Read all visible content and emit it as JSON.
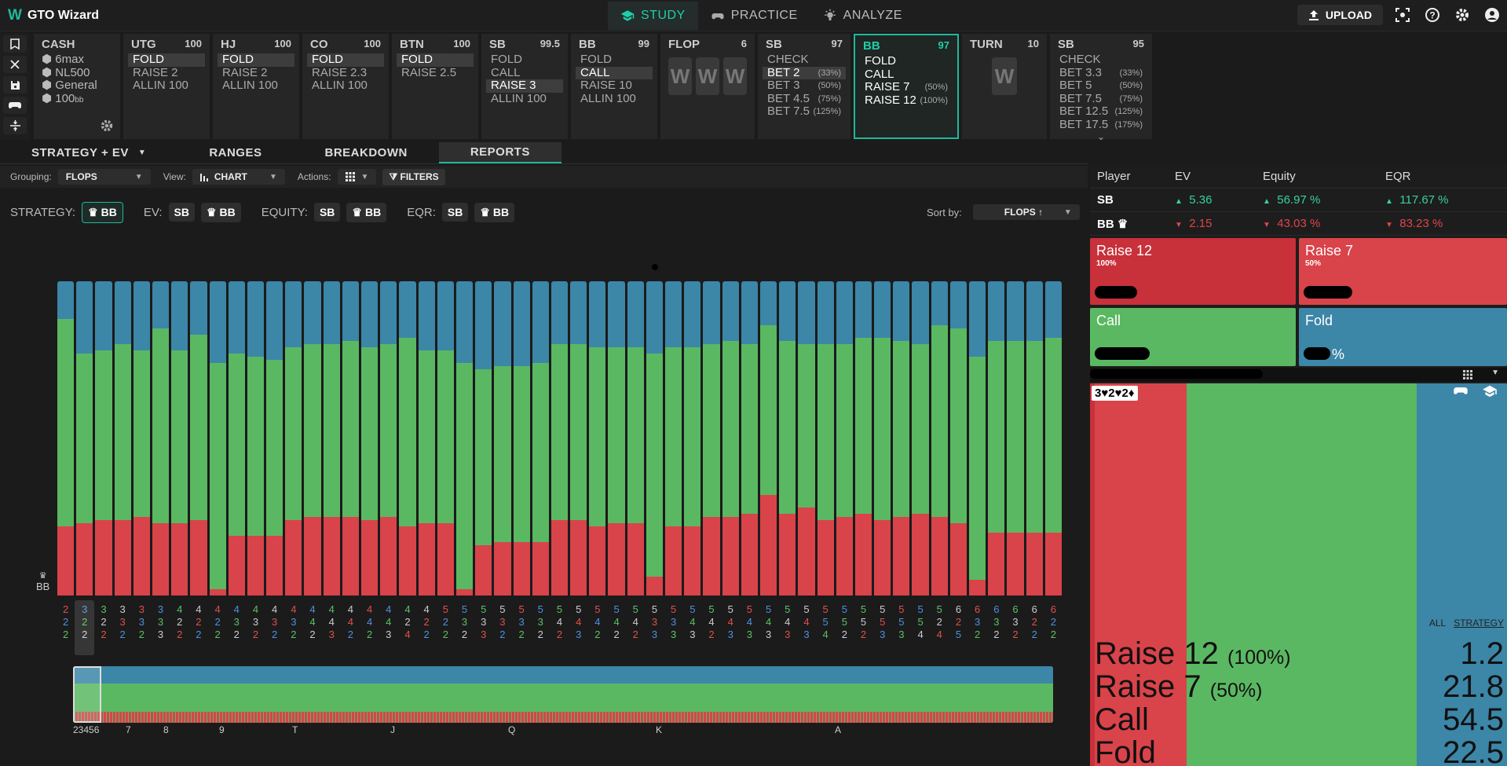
{
  "app": {
    "name": "GTO Wizard",
    "logo_letter": "W"
  },
  "nav": {
    "tabs": [
      {
        "label": "STUDY",
        "icon": "graduation-cap-icon",
        "active": true
      },
      {
        "label": "PRACTICE",
        "icon": "gamepad-icon",
        "active": false
      },
      {
        "label": "ANALYZE",
        "icon": "lightbulb-icon",
        "active": false
      }
    ]
  },
  "topright": {
    "upload_label": "UPLOAD"
  },
  "cash": {
    "title": "CASH",
    "rows": [
      "6max",
      "NL500",
      "General",
      "100"
    ],
    "unit": "bb"
  },
  "nodes": [
    {
      "name": "UTG",
      "stack": "100",
      "actions": [
        {
          "label": "FOLD",
          "sel": true
        },
        {
          "label": "RAISE 2"
        },
        {
          "label": "ALLIN 100"
        }
      ]
    },
    {
      "name": "HJ",
      "stack": "100",
      "actions": [
        {
          "label": "FOLD",
          "sel": true
        },
        {
          "label": "RAISE 2"
        },
        {
          "label": "ALLIN 100"
        }
      ]
    },
    {
      "name": "CO",
      "stack": "100",
      "actions": [
        {
          "label": "FOLD",
          "sel": true
        },
        {
          "label": "RAISE 2.3"
        },
        {
          "label": "ALLIN 100"
        }
      ]
    },
    {
      "name": "BTN",
      "stack": "100",
      "actions": [
        {
          "label": "FOLD",
          "sel": true
        },
        {
          "label": "RAISE 2.5"
        }
      ]
    },
    {
      "name": "SB",
      "stack": "99.5",
      "actions": [
        {
          "label": "FOLD"
        },
        {
          "label": "CALL"
        },
        {
          "label": "RAISE 3",
          "sel": true
        },
        {
          "label": "ALLIN 100"
        }
      ]
    },
    {
      "name": "BB",
      "stack": "99",
      "actions": [
        {
          "label": "FOLD"
        },
        {
          "label": "CALL",
          "sel": true
        },
        {
          "label": "RAISE 10"
        },
        {
          "label": "ALLIN 100"
        }
      ]
    }
  ],
  "flop": {
    "name": "FLOP",
    "count": "6",
    "card": "W"
  },
  "sb_node": {
    "name": "SB",
    "stack": "97",
    "actions": [
      {
        "label": "CHECK",
        "pct": ""
      },
      {
        "label": "BET 2",
        "pct": "(33%)",
        "sel": true
      },
      {
        "label": "BET 3",
        "pct": "(50%)"
      },
      {
        "label": "BET 4.5",
        "pct": "(75%)"
      },
      {
        "label": "BET 7.5",
        "pct": "(125%)"
      }
    ]
  },
  "bb_node": {
    "name": "BB",
    "stack": "97",
    "actions": [
      {
        "label": "FOLD",
        "pct": ""
      },
      {
        "label": "CALL",
        "pct": ""
      },
      {
        "label": "RAISE 7",
        "pct": "(50%)"
      },
      {
        "label": "RAISE 12",
        "pct": "(100%)"
      }
    ]
  },
  "turn": {
    "name": "TURN",
    "count": "10",
    "card": "W"
  },
  "sb2_node": {
    "name": "SB",
    "stack": "95",
    "actions": [
      {
        "label": "CHECK",
        "pct": ""
      },
      {
        "label": "BET 3.3",
        "pct": "(33%)"
      },
      {
        "label": "BET 5",
        "pct": "(50%)"
      },
      {
        "label": "BET 7.5",
        "pct": "(75%)"
      },
      {
        "label": "BET 12.5",
        "pct": "(125%)"
      },
      {
        "label": "BET 17.5",
        "pct": "(175%)"
      }
    ]
  },
  "subtabs": [
    {
      "label": "STRATEGY + EV",
      "dropdown": true
    },
    {
      "label": "RANGES"
    },
    {
      "label": "BREAKDOWN"
    },
    {
      "label": "REPORTS",
      "active": true
    }
  ],
  "toolbar": {
    "grouping_label": "Grouping:",
    "grouping_value": "FLOPS",
    "view_label": "View:",
    "view_value": "CHART",
    "actions_label": "Actions:",
    "filters_label": "FILTERS"
  },
  "toggles": {
    "strategy_label": "STRATEGY:",
    "ev_label": "EV:",
    "equity_label": "EQUITY:",
    "eqr_label": "EQR:",
    "sb": "SB",
    "bb": "BB",
    "sort_label": "Sort by:",
    "sort_value": "FLOPS"
  },
  "table": {
    "headers": [
      "Player",
      "EV",
      "Equity",
      "EQR"
    ],
    "rows": [
      {
        "player": "SB",
        "ev": "5.36",
        "equity": "56.97 %",
        "eqr": "117.67 %",
        "dir": "up"
      },
      {
        "player": "BB",
        "ev": "2.15",
        "equity": "43.03 %",
        "eqr": "83.23 %",
        "dir": "down"
      }
    ]
  },
  "action_boxes": [
    {
      "title": "Raise 12",
      "sub": "100%",
      "color": "#c8303a"
    },
    {
      "title": "Raise 7",
      "sub": "50%",
      "color": "#d9434a"
    },
    {
      "title": "Call",
      "sub": "",
      "color": "#5ab862"
    },
    {
      "title": "Fold",
      "sub": "",
      "suffix": "%",
      "color": "#3c86a7"
    }
  ],
  "detail": {
    "hand": "3♥2♥2♦",
    "all_label": "ALL",
    "strategy_label": "STRATEGY",
    "lines": [
      {
        "label": "Raise 12",
        "pct": "(100%)",
        "value": "1.2"
      },
      {
        "label": "Raise 7",
        "pct": "(50%)",
        "value": "21.8"
      },
      {
        "label": "Call",
        "pct": "",
        "value": "54.5"
      },
      {
        "label": "Fold",
        "pct": "",
        "value": "22.5"
      }
    ]
  },
  "colors": {
    "raise": "#d9434a",
    "call": "#5ab862",
    "fold": "#3c86a7",
    "accent": "#1fb89a"
  },
  "chart_data": {
    "type": "bar",
    "stacked": true,
    "y_label": "BB",
    "categories_row1": [
      "2",
      "3",
      "3",
      "3",
      "3",
      "3",
      "4",
      "4",
      "4",
      "4",
      "4",
      "4",
      "4",
      "4",
      "4",
      "4",
      "4",
      "4",
      "4",
      "4",
      "5",
      "5",
      "5",
      "5",
      "5",
      "5",
      "5",
      "5",
      "5",
      "5",
      "5",
      "5",
      "5",
      "5",
      "5",
      "5",
      "5",
      "5",
      "5",
      "5",
      "5",
      "5",
      "5",
      "5",
      "5",
      "5",
      "5",
      "6",
      "6",
      "6",
      "6",
      "6",
      "6"
    ],
    "categories_row2": [
      "2",
      "2",
      "2",
      "3",
      "3",
      "3",
      "2",
      "2",
      "2",
      "3",
      "3",
      "3",
      "3",
      "4",
      "4",
      "4",
      "4",
      "4",
      "2",
      "2",
      "2",
      "3",
      "3",
      "3",
      "3",
      "3",
      "4",
      "4",
      "4",
      "4",
      "4",
      "3",
      "3",
      "4",
      "4",
      "4",
      "4",
      "4",
      "4",
      "4",
      "5",
      "5",
      "5",
      "5",
      "5",
      "5",
      "2",
      "2",
      "3",
      "3",
      "3",
      "2",
      "2"
    ],
    "categories_row3": [
      "2",
      "2",
      "2",
      "2",
      "2",
      "3",
      "2",
      "2",
      "2",
      "2",
      "2",
      "2",
      "2",
      "2",
      "3",
      "2",
      "2",
      "3",
      "4",
      "2",
      "2",
      "2",
      "3",
      "2",
      "2",
      "2",
      "2",
      "3",
      "2",
      "2",
      "2",
      "3",
      "3",
      "3",
      "2",
      "3",
      "3",
      "3",
      "3",
      "3",
      "4",
      "2",
      "2",
      "3",
      "3",
      "4",
      "4",
      "5",
      "2",
      "2",
      "2",
      "2",
      "2"
    ],
    "series": [
      {
        "name": "Raise",
        "values": [
          22,
          23,
          24,
          24,
          25,
          23,
          23,
          24,
          2,
          19,
          19,
          19,
          24,
          25,
          25,
          25,
          24,
          25,
          22,
          23,
          23,
          2,
          16,
          17,
          17,
          17,
          24,
          24,
          22,
          23,
          23,
          6,
          22,
          22,
          25,
          25,
          26,
          32,
          26,
          28,
          24,
          25,
          26,
          24,
          25,
          26,
          25,
          23,
          5,
          20,
          20,
          20,
          20
        ]
      },
      {
        "name": "Call",
        "values": [
          66,
          54,
          54,
          56,
          53,
          62,
          55,
          59,
          72,
          58,
          57,
          56,
          55,
          55,
          55,
          56,
          55,
          55,
          60,
          55,
          55,
          72,
          56,
          56,
          56,
          57,
          56,
          56,
          57,
          56,
          56,
          71,
          57,
          57,
          55,
          56,
          54,
          54,
          55,
          52,
          56,
          55,
          56,
          58,
          56,
          54,
          61,
          62,
          71,
          61,
          61,
          61,
          62
        ]
      },
      {
        "name": "Fold",
        "values": [
          12,
          23,
          22,
          20,
          22,
          15,
          22,
          17,
          26,
          23,
          24,
          25,
          21,
          20,
          20,
          19,
          21,
          20,
          18,
          22,
          22,
          26,
          28,
          27,
          27,
          26,
          20,
          20,
          21,
          21,
          21,
          23,
          21,
          21,
          20,
          19,
          20,
          14,
          19,
          20,
          20,
          20,
          18,
          18,
          19,
          20,
          14,
          15,
          24,
          19,
          19,
          19,
          18
        ]
      }
    ],
    "ylim": [
      0,
      100
    ],
    "minimap_labels": [
      "23456",
      "7",
      "8",
      "9",
      "T",
      "J",
      "Q",
      "K",
      "A"
    ]
  }
}
